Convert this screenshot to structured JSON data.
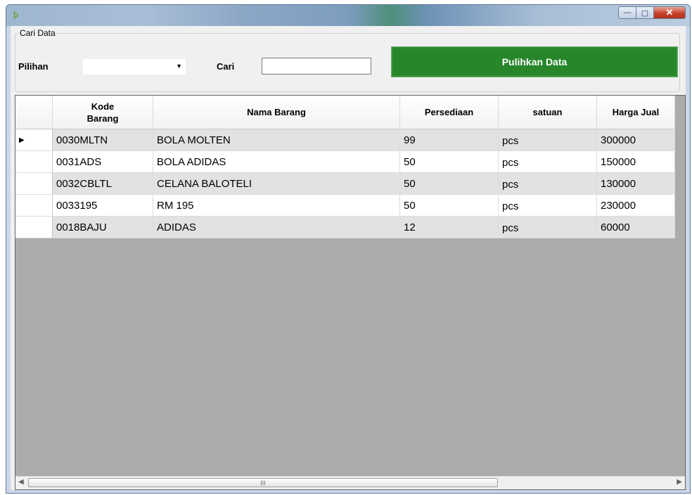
{
  "window": {
    "app_icon": "app-logo-icon",
    "minimize_glyph": "—",
    "maximize_glyph": "▢",
    "close_glyph": "✕"
  },
  "search": {
    "group_title": "Cari Data",
    "pilihan_label": "Pilihan",
    "pilihan_value": "",
    "cari_label": "Cari",
    "cari_value": "",
    "restore_button": "Pulihkan Data"
  },
  "grid": {
    "columns": [
      "Kode\nBarang",
      "Nama Barang",
      "Persediaan",
      "satuan",
      "Harga Jual"
    ],
    "current_row_glyph": "▶",
    "rows": [
      {
        "kode": "0030MLTN",
        "nama": "BOLA MOLTEN",
        "persediaan": "99",
        "satuan": "pcs",
        "harga": "300000"
      },
      {
        "kode": "0031ADS",
        "nama": "BOLA ADIDAS",
        "persediaan": "50",
        "satuan": "pcs",
        "harga": "150000"
      },
      {
        "kode": "0032CBLTL",
        "nama": "CELANA BALOTELI",
        "persediaan": "50",
        "satuan": "pcs",
        "harga": "130000"
      },
      {
        "kode": "0033195",
        "nama": "RM 195",
        "persediaan": "50",
        "satuan": "pcs",
        "harga": "230000"
      },
      {
        "kode": "0018BAJU",
        "nama": "ADIDAS",
        "persediaan": "12",
        "satuan": "pcs",
        "harga": "60000"
      }
    ]
  },
  "scrollbar": {
    "left_arrow": "◀",
    "right_arrow": "▶",
    "thumb_grip": "III"
  },
  "colors": {
    "restore_button_bg": "#28862a",
    "grid_empty_bg": "#ababab",
    "alt_row_bg": "#e2e2e2"
  }
}
